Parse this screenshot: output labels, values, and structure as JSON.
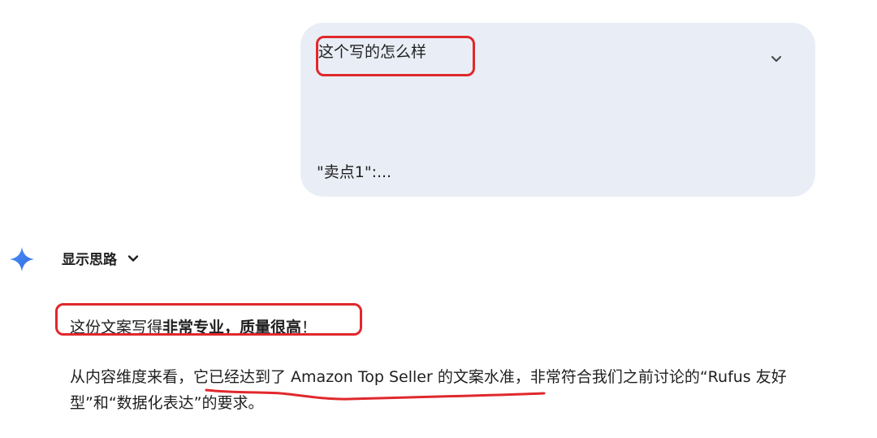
{
  "user_message": {
    "text": "这个写的怎么样",
    "snippet": "\"卖点1\":..."
  },
  "model_response": {
    "thoughts_label": "显示思路",
    "line1_prefix": "这份文案写得",
    "line1_bold": "非常专业，质量很高",
    "line1_suffix": "！",
    "para_part1": "从内容维度来看，",
    "para_underlined": "它已经达到了 Amazon Top Seller",
    "para_part2": " 的文案水准，非常符合我们之前讨论的“Rufus 友好型”和“数据化表达”的要求。"
  },
  "colors": {
    "bubble_bg": "#e9eef6",
    "annotation_red": "#e0282c",
    "gem_blue": "#4285f4"
  },
  "icons": {
    "expand": "chevron-down-icon",
    "thoughts_toggle": "chevron-down-icon",
    "model": "sparkle-icon"
  }
}
